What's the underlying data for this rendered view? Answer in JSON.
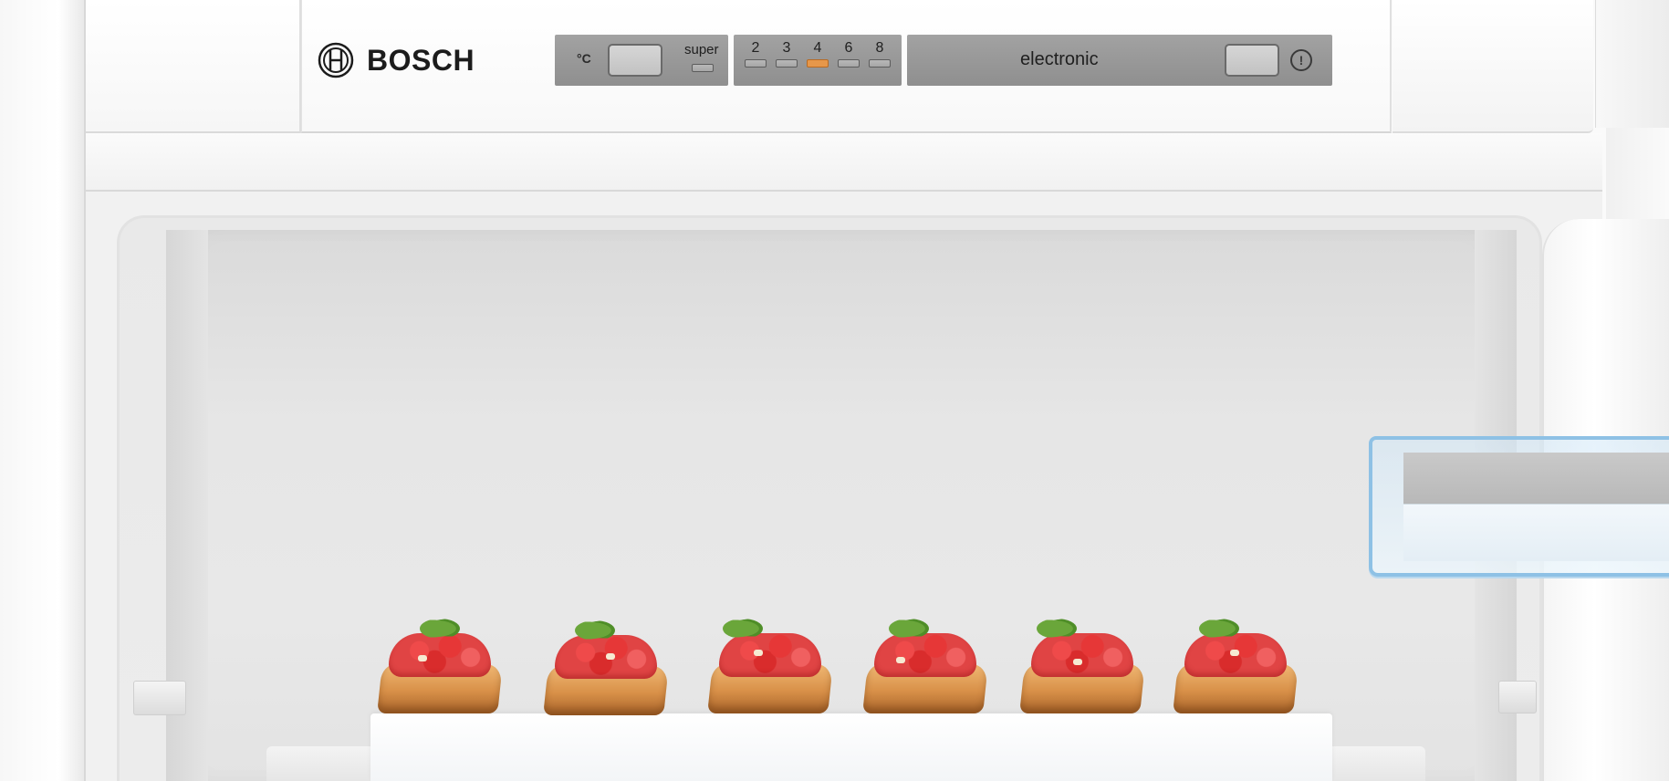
{
  "brand": {
    "name": "BOSCH"
  },
  "control_panel": {
    "temperature_unit": "°C",
    "super_label": "super",
    "temperature_levels": [
      "2",
      "3",
      "4",
      "6",
      "8"
    ],
    "selected_level": "4",
    "mode_label": "electronic",
    "indicator_on_color": "#e6974a",
    "panel_color": "#979797"
  },
  "scene": {
    "food_items": 6,
    "door_bin_trim_color": "#8ec1e5"
  }
}
